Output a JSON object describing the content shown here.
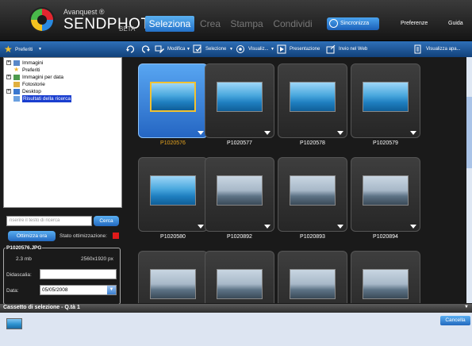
{
  "header": {
    "brand_top": "Avanquest ®",
    "brand_name": "SENDPHOTOS",
    "brand_suffix": "BETA",
    "tabs": [
      {
        "label": "Seleziona",
        "active": true
      },
      {
        "label": "Crea",
        "active": false
      },
      {
        "label": "Stampa",
        "active": false
      },
      {
        "label": "Condividi",
        "active": false
      }
    ],
    "sync_label": "Sincronizza",
    "preferences_label": "Preferenze",
    "guide_label": "Guida"
  },
  "left_bar": {
    "favorites_label": "Preferiti"
  },
  "toolbar": {
    "edit_label": "Modifica",
    "select_label": "Selezione",
    "view_label": "Visualiz...",
    "presentation_label": "Presentazione",
    "web_label": "Invio nel Web",
    "open_label": "Visualizza apa..."
  },
  "tree": {
    "items": [
      {
        "label": "Immagini",
        "expandable": true,
        "selected": false
      },
      {
        "label": "Preferiti",
        "expandable": false,
        "selected": false
      },
      {
        "label": "Immagini per data",
        "expandable": true,
        "selected": false
      },
      {
        "label": "Fotostorie",
        "expandable": false,
        "selected": false
      },
      {
        "label": "Desktop",
        "expandable": true,
        "selected": false
      },
      {
        "label": "Risultati della ricerca",
        "expandable": false,
        "selected": true
      }
    ]
  },
  "search": {
    "placeholder": "nserire il testo di ricerca",
    "button_label": "Cerca",
    "optimize_label": "Ottimizza ora",
    "status_label": "Stato ottimizzazione:",
    "status_color": "#e01a1a"
  },
  "info": {
    "title": "P1020576.JPG",
    "size": "2.3 mb",
    "dimensions": "2560x1920 px",
    "caption_label": "Didascalia:",
    "caption_value": "",
    "date_label": "Data:",
    "date_value": "05/05/2008"
  },
  "thumbnails": [
    {
      "label": "P1020576",
      "selected": true,
      "kind": "beach"
    },
    {
      "label": "P1020577",
      "selected": false,
      "kind": "beach"
    },
    {
      "label": "P1020578",
      "selected": false,
      "kind": "beach"
    },
    {
      "label": "P1020579",
      "selected": false,
      "kind": "beach"
    },
    {
      "label": "P1020580",
      "selected": false,
      "kind": "beach"
    },
    {
      "label": "P1020892",
      "selected": false,
      "kind": "city"
    },
    {
      "label": "P1020893",
      "selected": false,
      "kind": "city"
    },
    {
      "label": "P1020894",
      "selected": false,
      "kind": "city"
    },
    {
      "label": "",
      "selected": false,
      "kind": "city"
    },
    {
      "label": "",
      "selected": false,
      "kind": "city"
    },
    {
      "label": "",
      "selected": false,
      "kind": "city"
    },
    {
      "label": "",
      "selected": false,
      "kind": "city"
    }
  ],
  "bottom": {
    "title": "Cassetto di selezione - Q.tà 1",
    "cancel_label": "Cancella"
  },
  "colors": {
    "accent": "#2a7ad6",
    "selected_label": "#e7a520"
  }
}
